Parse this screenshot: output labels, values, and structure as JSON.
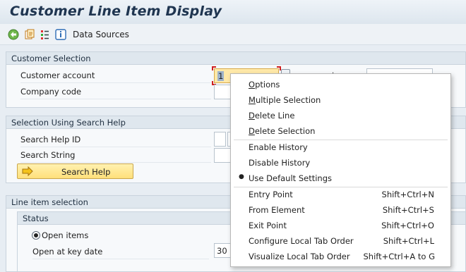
{
  "app": {
    "title": "Customer Line Item Display"
  },
  "toolbar": {
    "icons": [
      "execute-icon",
      "variant-icon",
      "selection-options-icon",
      "info-icon"
    ],
    "data_sources_label": "Data Sources"
  },
  "customer_selection": {
    "header": "Customer Selection",
    "customer_account_label": "Customer account",
    "customer_account_value": "1",
    "to_label": "to",
    "company_code_label": "Company code"
  },
  "search_help_section": {
    "header": "Selection Using Search Help",
    "search_help_id_label": "Search Help ID",
    "search_string_label": "Search String",
    "search_help_button": "Search Help"
  },
  "line_item_selection": {
    "header": "Line item selection",
    "status_header": "Status",
    "open_items_label": "Open items",
    "open_at_key_date_label": "Open at key date",
    "key_date_value": "30"
  },
  "context_menu": {
    "items": [
      {
        "pre": "",
        "ul": "O",
        "post": "ptions",
        "shortcut": ""
      },
      {
        "pre": "",
        "ul": "M",
        "post": "ultiple Selection",
        "shortcut": ""
      },
      {
        "pre": "",
        "ul": "D",
        "post": "elete Line",
        "shortcut": ""
      },
      {
        "pre": "",
        "ul": "D",
        "post": "elete Selection",
        "shortcut": ""
      },
      {
        "pre": "Enable History",
        "ul": "",
        "post": "",
        "shortcut": ""
      },
      {
        "pre": "Disable History",
        "ul": "",
        "post": "",
        "shortcut": ""
      },
      {
        "pre": "Use Default Settings",
        "ul": "",
        "post": "",
        "shortcut": "",
        "bullet": "●"
      },
      {
        "pre": "Entry Point",
        "ul": "",
        "post": "",
        "shortcut": "Shift+Ctrl+N"
      },
      {
        "pre": "From Element",
        "ul": "",
        "post": "",
        "shortcut": "Shift+Ctrl+S"
      },
      {
        "pre": "Exit Point",
        "ul": "",
        "post": "",
        "shortcut": "Shift+Ctrl+O"
      },
      {
        "pre": "Configure Local Tab Order",
        "ul": "",
        "post": "",
        "shortcut": "Shift+Ctrl+L"
      },
      {
        "pre": "Visualize Local Tab Order",
        "ul": "",
        "post": "",
        "shortcut": "Shift+Ctrl+A to G"
      }
    ]
  }
}
